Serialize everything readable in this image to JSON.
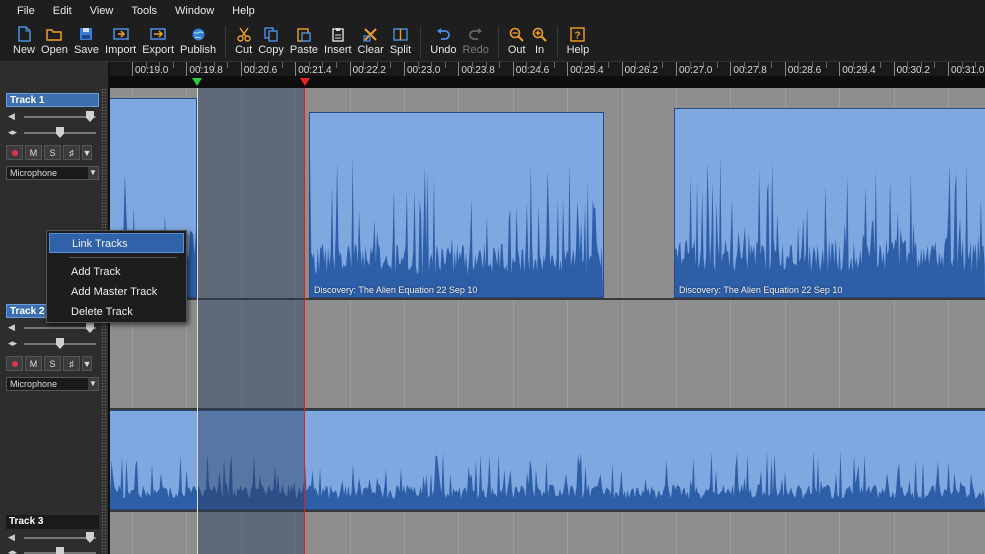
{
  "menu": [
    "File",
    "Edit",
    "View",
    "Tools",
    "Window",
    "Help"
  ],
  "toolbar": {
    "new": "New",
    "open": "Open",
    "save": "Save",
    "import": "Import",
    "export": "Export",
    "publish": "Publish",
    "cut": "Cut",
    "copy": "Copy",
    "paste": "Paste",
    "insert": "Insert",
    "clear": "Clear",
    "split": "Split",
    "undo": "Undo",
    "redo": "Redo",
    "zoom_out": "Out",
    "zoom_in": "In",
    "help": "Help"
  },
  "ruler": {
    "labels": [
      "00:19.0",
      "00:19.8",
      "00:20.6",
      "00:21.4",
      "00:22.2",
      "00:23.0",
      "00:23.8",
      "00:24.6",
      "00:25.4",
      "00:26.2",
      "00:27.0",
      "00:27.8",
      "00:28.6",
      "00:29.4",
      "00:30.2",
      "00:31.0"
    ]
  },
  "tracks": [
    {
      "name": "Track 1",
      "source": "Microphone",
      "selected": true
    },
    {
      "name": "Track 2",
      "source": "Microphone",
      "selected": true
    },
    {
      "name": "Track 3",
      "source": "",
      "selected": false
    }
  ],
  "track_buttons": {
    "mute": "M",
    "solo": "S",
    "fx": "♯",
    "more": "▼"
  },
  "clips": {
    "clip_label_1": "Discovery: The Alien Equation 22 Sep 10",
    "clip_label_2": "Discovery: The Alien Equation 22 Sep 10"
  },
  "context_menu": {
    "link_tracks": "Link Tracks",
    "add_track": "Add Track",
    "add_master_track": "Add Master Track",
    "delete_track": "Delete Track"
  },
  "colors": {
    "accent": "#2f62a8",
    "clip": "#7fa7e0",
    "wave": "#2d5ea8",
    "cursor": "#e02020",
    "play_marker": "#2ecc40"
  }
}
